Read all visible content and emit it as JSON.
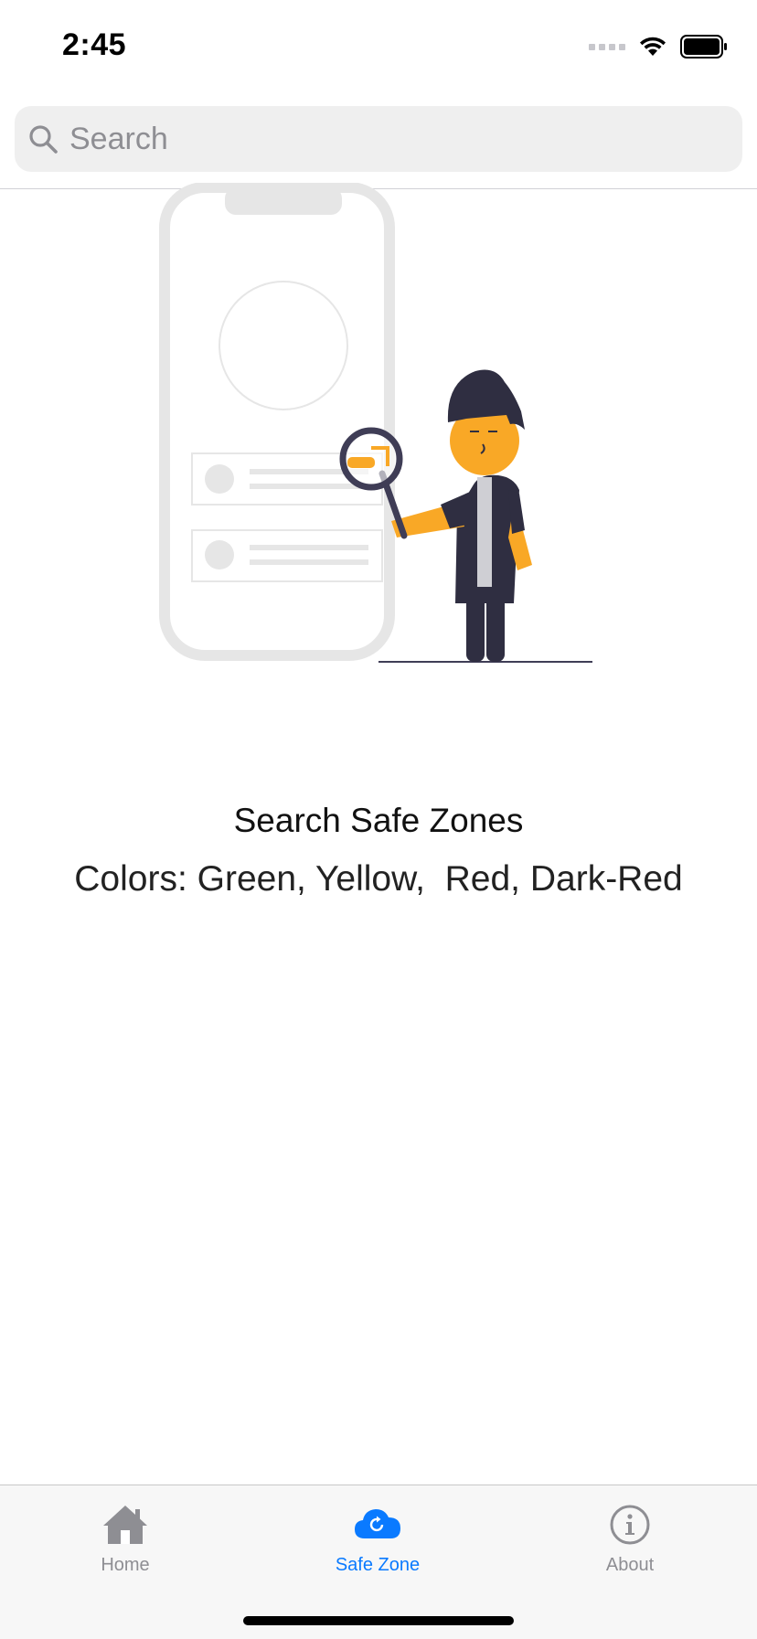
{
  "status_bar": {
    "time": "2:45",
    "icons": [
      "cellular-signal-icon",
      "wifi-icon",
      "battery-icon"
    ]
  },
  "search": {
    "placeholder": "Search",
    "value": ""
  },
  "illustration": {
    "name": "person-with-magnifier-and-phone",
    "colors": {
      "accent": "#f9a826",
      "dark": "#2f2e41",
      "outline": "#e6e6e6"
    }
  },
  "content": {
    "title": "Search Safe Zones",
    "subtitle": "Colors: Green, Yellow,  Red, Dark-Red"
  },
  "tab_bar": {
    "tabs": [
      {
        "label": "Home",
        "icon": "house-icon",
        "active": false
      },
      {
        "label": "Safe Zone",
        "icon": "cloud-refresh-icon",
        "active": true
      },
      {
        "label": "About",
        "icon": "info-circle-icon",
        "active": false
      }
    ],
    "active_color": "#0a7aff",
    "inactive_color": "#8e8e93"
  }
}
